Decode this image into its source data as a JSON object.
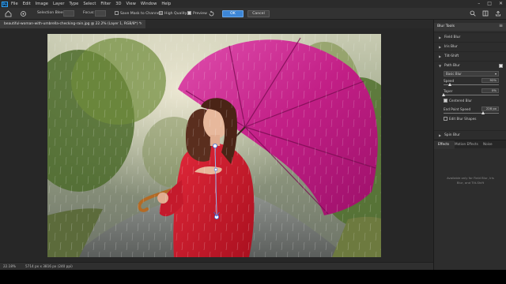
{
  "menu": {
    "items": [
      "File",
      "Edit",
      "Image",
      "Layer",
      "Type",
      "Select",
      "Filter",
      "3D",
      "View",
      "Window",
      "Help"
    ],
    "app_logo": "Ps",
    "window_controls": [
      "–",
      "□",
      "✕"
    ]
  },
  "options": {
    "selection_bleed_label": "Selection Bleed:",
    "focus_label": "Focus:",
    "save_mask_label": "Save Mask to Channels",
    "high_quality_label": "High Quality",
    "preview_label": "Preview",
    "preview_checked": true,
    "ok_label": "OK",
    "cancel_label": "Cancel",
    "accent": "#3d86d6"
  },
  "document": {
    "tab_title": "beautiful-woman-with-umbrella-checking-rain.jpg @ 22.2% (Layer 1, RGB/8*) *",
    "tab_close": "×"
  },
  "status": {
    "zoom": "22.18%",
    "doc_size": "5714 px x 3816 px (240 ppi)"
  },
  "panel": {
    "title": "Blur Tools",
    "menu_icon": "≡",
    "blurs": [
      {
        "label": "Field Blur",
        "checked": false
      },
      {
        "label": "Iris Blur",
        "checked": false
      },
      {
        "label": "Tilt-Shift",
        "checked": false
      },
      {
        "label": "Path Blur",
        "checked": true
      },
      {
        "label": "Spin Blur",
        "checked": false
      }
    ],
    "path_blur": {
      "type": "Basic Blur",
      "speed_label": "Speed",
      "speed_value": "92%",
      "speed_fraction": 0.12,
      "taper_label": "Taper",
      "taper_value": "0%",
      "taper_fraction": 0.0,
      "centered_label": "Centered Blur",
      "centered_checked": true,
      "end_speed_label": "End Point Speed",
      "end_speed_value": "228 px",
      "end_speed_fraction": 0.72,
      "edit_shapes_label": "Edit Blur Shapes",
      "edit_shapes_checked": false
    },
    "tabs": [
      "Effects",
      "Motion Effects",
      "Noise"
    ],
    "info_text": "Available only for Field Blur, Iris Blur, and Tilt-Shift"
  }
}
